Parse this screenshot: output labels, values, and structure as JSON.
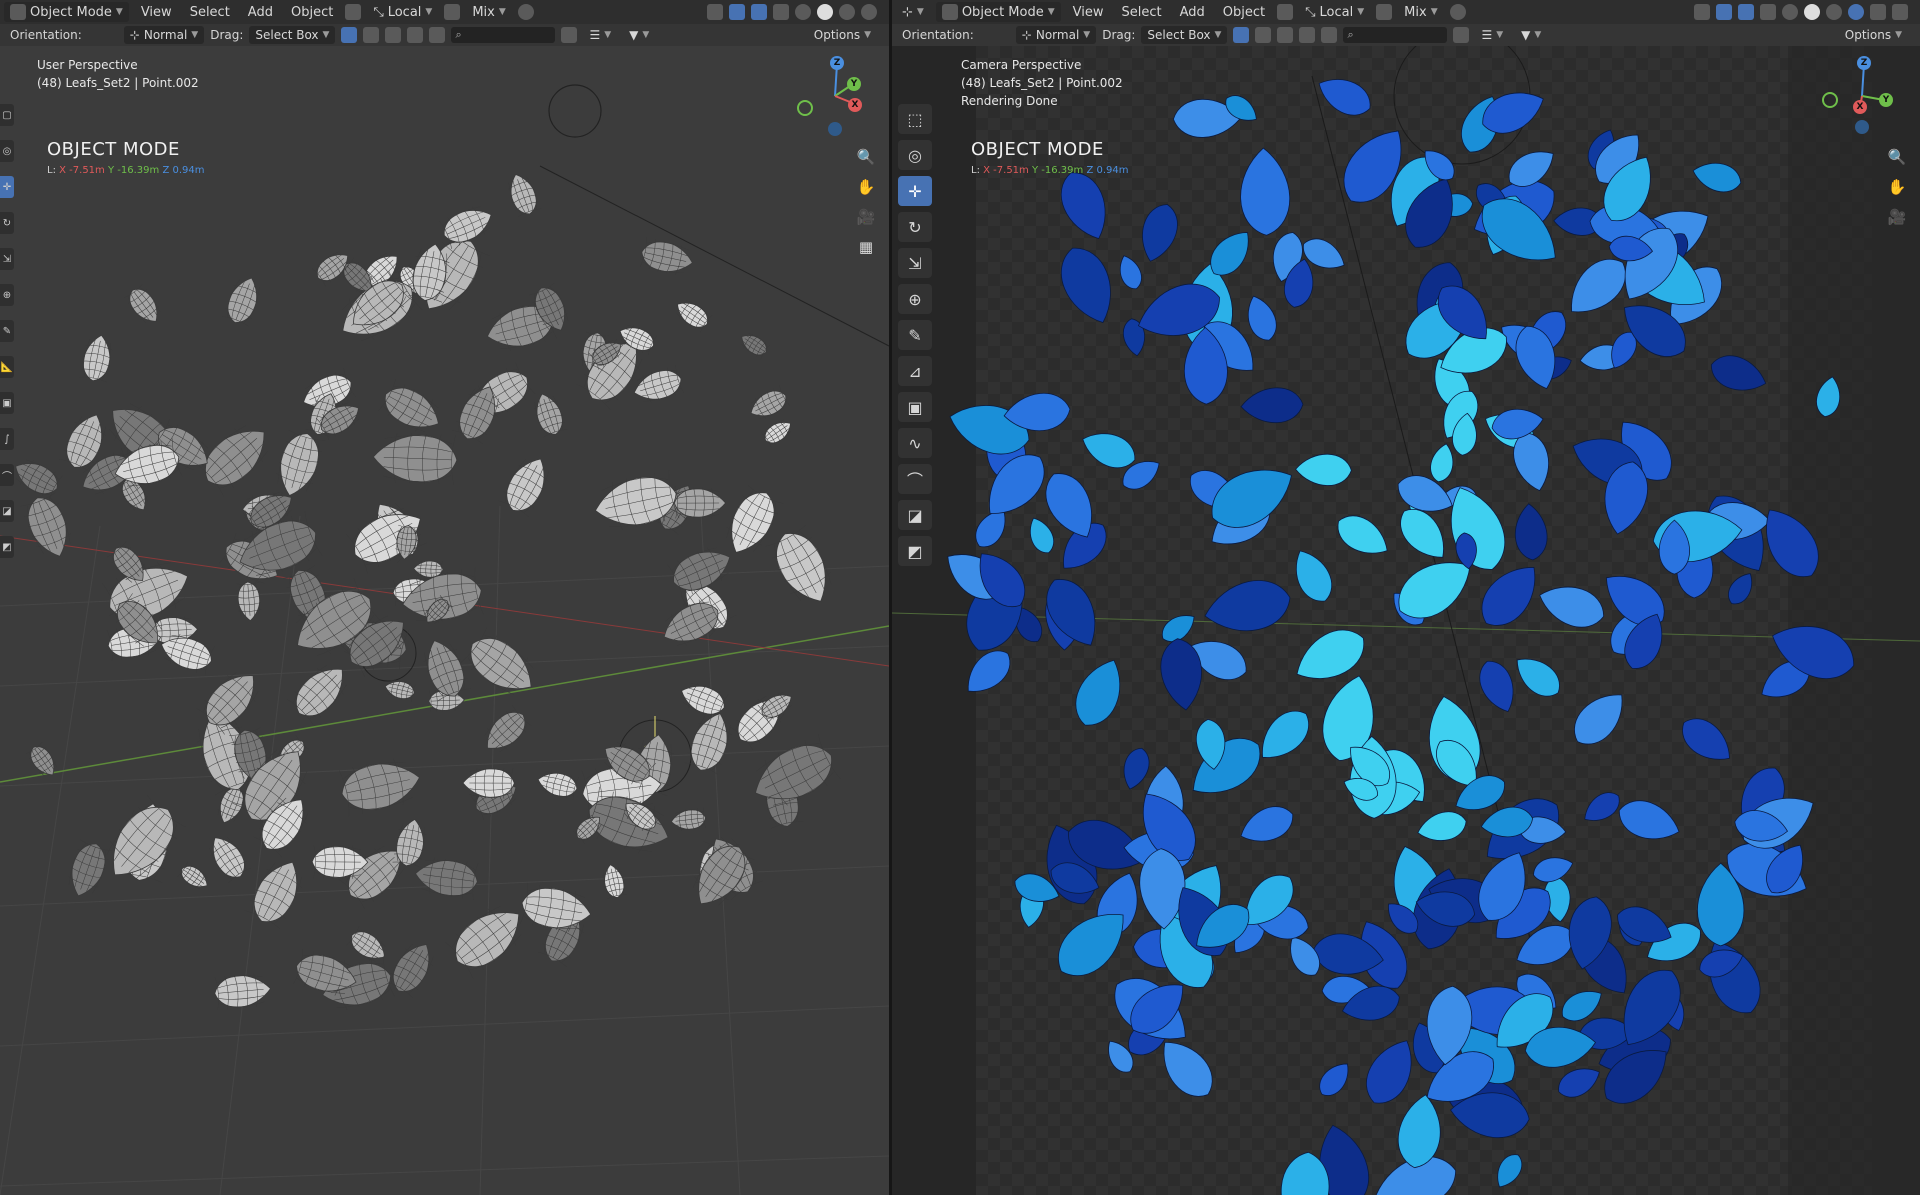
{
  "header": {
    "mode": "Object Mode",
    "menus": [
      "View",
      "Select",
      "Add",
      "Object"
    ],
    "transform_space": "Local",
    "pivot": "Mix"
  },
  "tool_header": {
    "orientation_label": "Orientation:",
    "orientation_value": "Normal",
    "drag_label": "Drag:",
    "drag_value": "Select Box",
    "options": "Options"
  },
  "left_viewport": {
    "view_name": "User Perspective",
    "object_info": "(48) Leafs_Set2 | Point.002",
    "mode_title": "OBJECT MODE",
    "coords": {
      "prefix": "L:",
      "x": "X -7.51m",
      "y": "Y -16.39m",
      "z": "Z 0.94m"
    }
  },
  "right_viewport": {
    "view_name": "Camera Perspective",
    "object_info": "(48) Leafs_Set2 | Point.002",
    "status": "Rendering Done",
    "mode_title": "OBJECT MODE",
    "coords": {
      "prefix": "L:",
      "x": "X -7.51m",
      "y": "Y -16.39m",
      "z": "Z 0.94m"
    }
  },
  "gizmo": {
    "z": "Z",
    "y": "Y",
    "x": "X"
  },
  "colors": {
    "accent": "#4772b3",
    "axis_x": "#e05a5a",
    "axis_y": "#6fbf4a",
    "axis_z": "#4a8fe0",
    "leaf_solid": "#bdbdbd",
    "leaf_render": "#1f6ad6"
  },
  "icons": {
    "nav": [
      "zoom-icon",
      "pan-hand-icon",
      "camera-icon",
      "grid-icon"
    ],
    "tools": [
      "select-box-icon",
      "cursor-icon",
      "move-icon",
      "rotate-icon",
      "scale-icon",
      "transform-icon",
      "annotate-icon",
      "measure-icon",
      "add-cube-icon",
      "draw-icon",
      "curve-icon",
      "shear-icon",
      "bevel-icon"
    ]
  }
}
